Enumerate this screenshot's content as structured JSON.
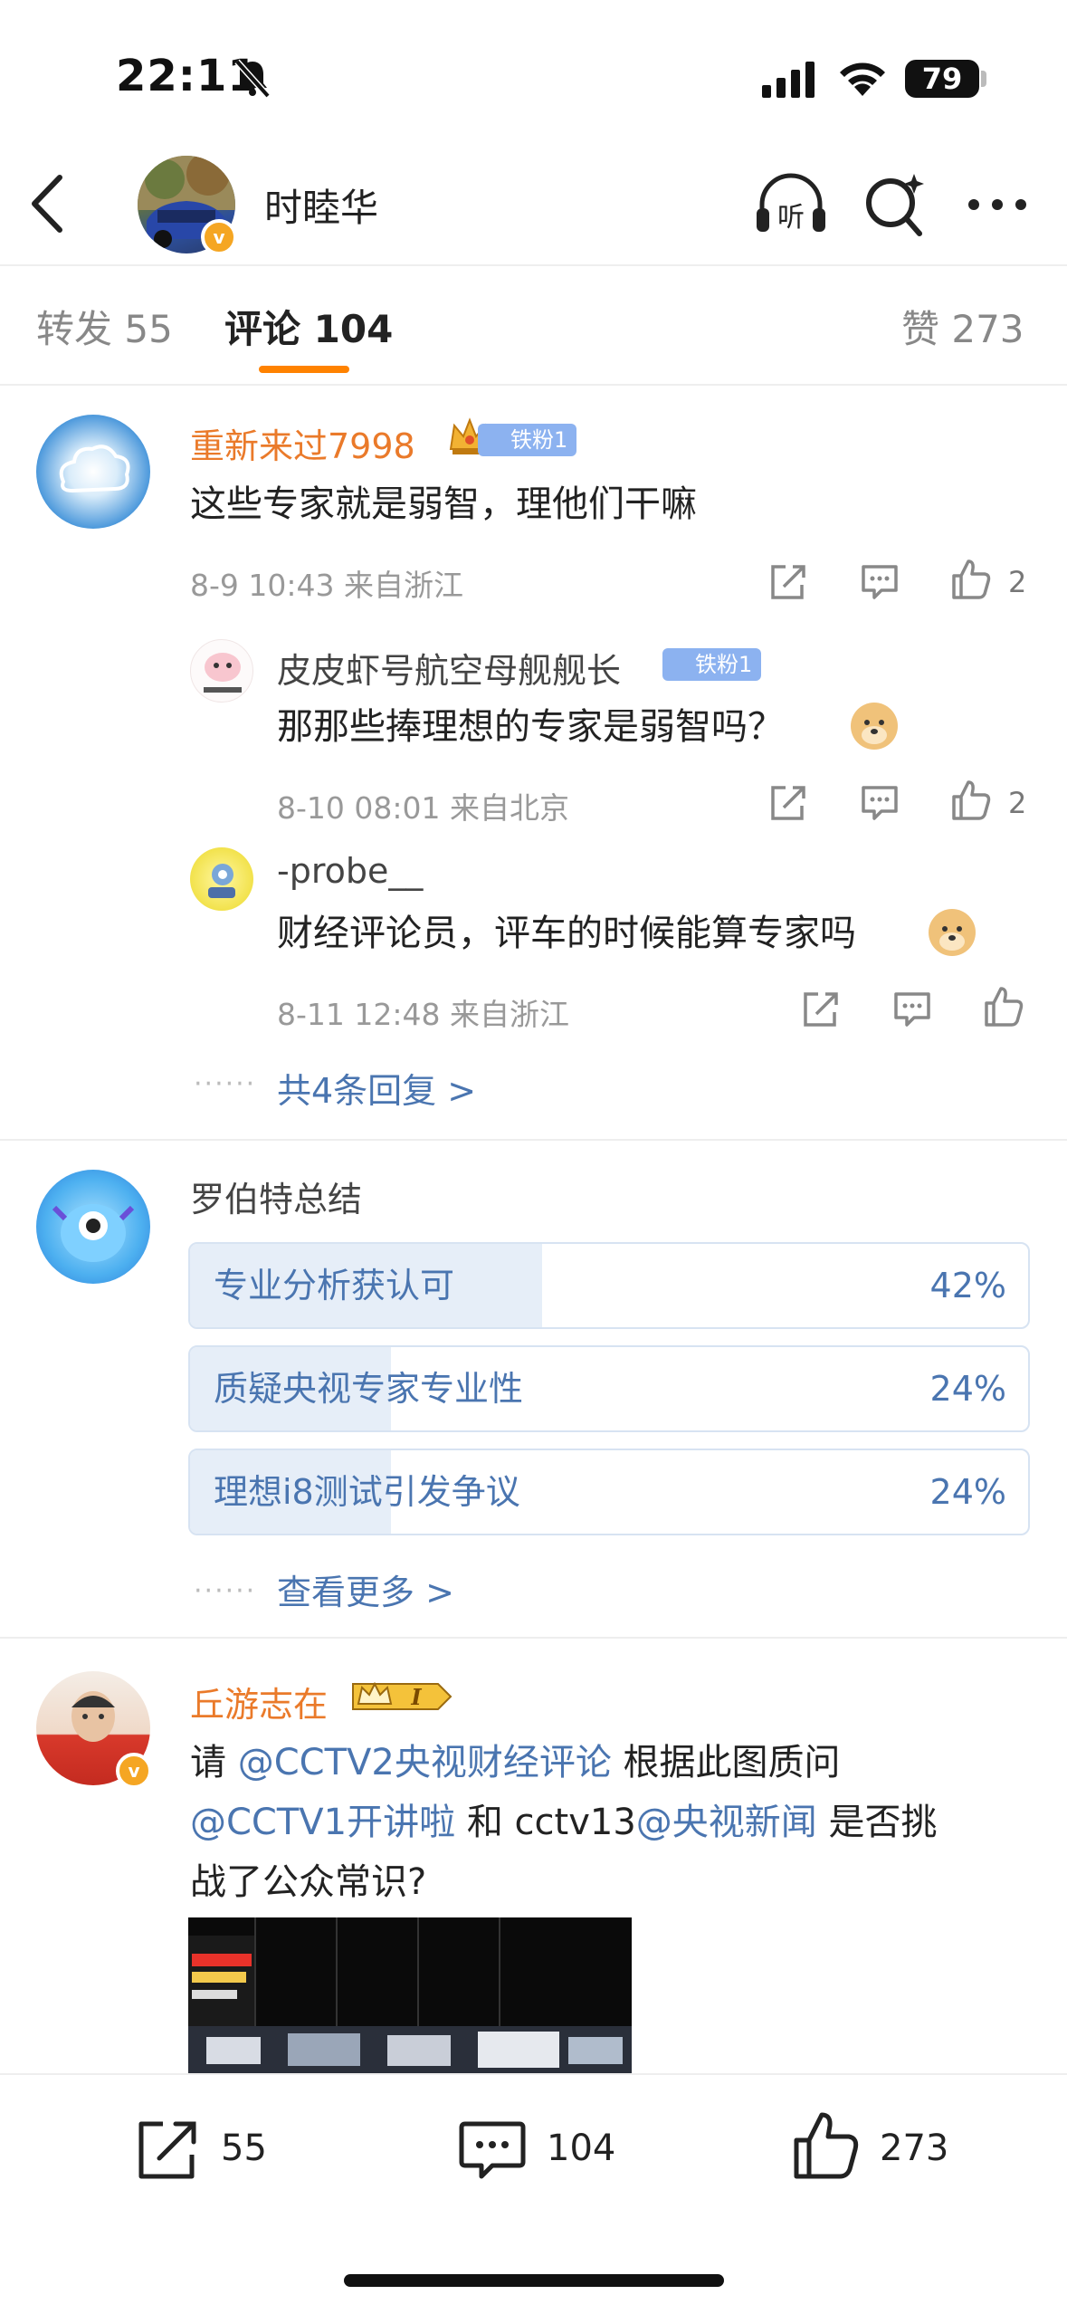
{
  "status_bar": {
    "time": "22:11",
    "battery": "79"
  },
  "nav": {
    "title": "时睦华",
    "badge": "v",
    "listen_label": "听"
  },
  "tabs": {
    "repost": "转发 55",
    "comments": "评论 104",
    "likes": "赞 273"
  },
  "comment1": {
    "username": "重新来过7998",
    "fan_badge": "铁粉1",
    "text": "这些专家就是弱智，理他们干嘛",
    "meta": "8-9 10:43  来自浙江",
    "likes": "2",
    "replies": [
      {
        "username": "皮皮虾号航空母舰舰长",
        "fan_badge": "铁粉1",
        "text": "那那些捧理想的专家是弱智吗？",
        "meta": "8-10 08:01  来自北京",
        "likes": "2"
      },
      {
        "username": "-probe__",
        "text": "财经评论员，评车的时候能算专家吗",
        "meta": "8-11 12:48  来自浙江",
        "likes": ""
      }
    ],
    "more_dots": "······",
    "more_replies": "共4条回复 >"
  },
  "poll": {
    "username": "罗伯特总结",
    "options": [
      {
        "label": "专业分析获认可",
        "pct": "42%",
        "value": 0.42
      },
      {
        "label": "质疑央视专家专业性",
        "pct": "24%",
        "value": 0.24
      },
      {
        "label": "理想i8测试引发争议",
        "pct": "24%",
        "value": 0.24
      }
    ],
    "more_dots": "······",
    "more_link": "查看更多 >"
  },
  "comment3": {
    "username": "丘游志在",
    "badge": "v",
    "rank_badge": "I",
    "text_parts": {
      "p1": "请 ",
      "mention1": "@CCTV2央视财经评论",
      "p2": " 根据此图质问",
      "mention2": "@CCTV1开讲啦",
      "p3": " 和 cctv13",
      "mention3": "@央视新闻",
      "p4": " 是否挑",
      "line3": "战了公众常识?"
    }
  },
  "bottom_bar": {
    "repost": "55",
    "comment": "104",
    "like": "273"
  },
  "colors": {
    "accent": "#ff8200",
    "link": "#4a75b0",
    "username": "#ea7a2a"
  }
}
